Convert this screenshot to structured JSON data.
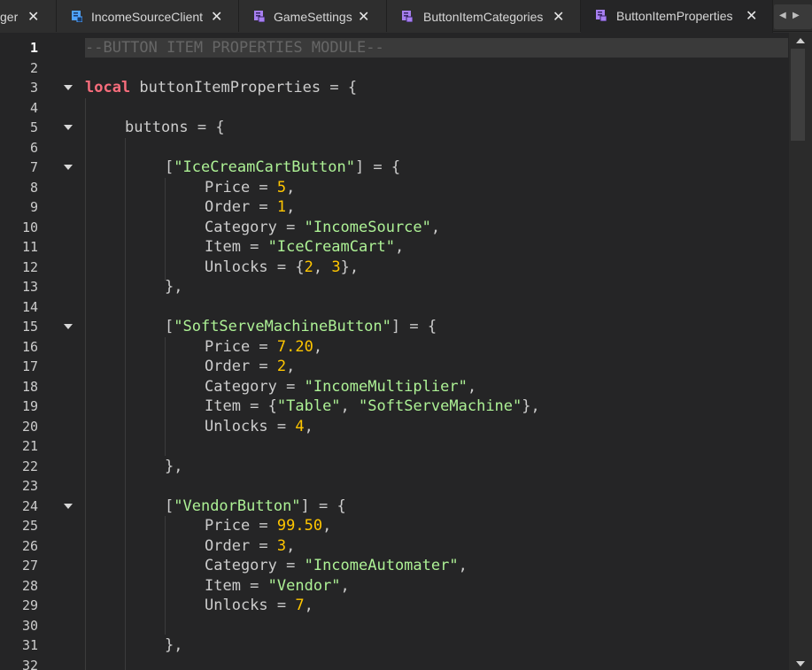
{
  "tabs": [
    {
      "label": "ger",
      "icon": "script-icon",
      "active": false
    },
    {
      "label": "IncomeSourceClient",
      "icon": "local-script-icon",
      "active": false
    },
    {
      "label": "GameSettings",
      "icon": "module-script-icon",
      "active": false
    },
    {
      "label": "ButtonItemCategories",
      "icon": "module-script-icon",
      "active": false
    },
    {
      "label": "ButtonItemProperties",
      "icon": "module-script-icon",
      "active": true
    }
  ],
  "colors": {
    "keyword": "#f86d7c",
    "string": "#adf195",
    "number": "#ffc600",
    "comment": "#666666",
    "text": "#cccccc",
    "local_script_icon": "#4fa3ff",
    "module_script_icon": "#a77ff0"
  },
  "editor": {
    "current_line": 1,
    "lines": [
      {
        "n": "1"
      },
      {
        "n": "2"
      },
      {
        "n": "3"
      },
      {
        "n": "4"
      },
      {
        "n": "5"
      },
      {
        "n": "6"
      },
      {
        "n": "7"
      },
      {
        "n": "8"
      },
      {
        "n": "9"
      },
      {
        "n": "10"
      },
      {
        "n": "11"
      },
      {
        "n": "12"
      },
      {
        "n": "13"
      },
      {
        "n": "14"
      },
      {
        "n": "15"
      },
      {
        "n": "16"
      },
      {
        "n": "17"
      },
      {
        "n": "18"
      },
      {
        "n": "19"
      },
      {
        "n": "20"
      },
      {
        "n": "21"
      },
      {
        "n": "22"
      },
      {
        "n": "23"
      },
      {
        "n": "24"
      },
      {
        "n": "25"
      },
      {
        "n": "26"
      },
      {
        "n": "27"
      },
      {
        "n": "28"
      },
      {
        "n": "29"
      },
      {
        "n": "30"
      },
      {
        "n": "31"
      },
      {
        "n": "32"
      }
    ],
    "code": {
      "l1": "--BUTTON ITEM PROPERTIES MODULE--",
      "l3_kw": "local",
      "l3_rest": " buttonItemProperties = {",
      "l5": "buttons = {",
      "l7_a": "[",
      "l7_s": "\"IceCreamCartButton\"",
      "l7_b": "] = {",
      "l8_a": "Price = ",
      "l8_n": "5",
      "l8_b": ",",
      "l9_a": "Order = ",
      "l9_n": "1",
      "l9_b": ",",
      "l10_a": "Category = ",
      "l10_s": "\"IncomeSource\"",
      "l10_b": ",",
      "l11_a": "Item = ",
      "l11_s": "\"IceCreamCart\"",
      "l11_b": ",",
      "l12_a": "Unlocks = {",
      "l12_n1": "2",
      "l12_c": ", ",
      "l12_n2": "3",
      "l12_b": "},",
      "l13": "},",
      "l15_a": "[",
      "l15_s": "\"SoftServeMachineButton\"",
      "l15_b": "] = {",
      "l16_a": "Price = ",
      "l16_n": "7.20",
      "l16_b": ",",
      "l17_a": "Order = ",
      "l17_n": "2",
      "l17_b": ",",
      "l18_a": "Category = ",
      "l18_s": "\"IncomeMultiplier\"",
      "l18_b": ",",
      "l19_a": "Item = {",
      "l19_s1": "\"Table\"",
      "l19_c": ", ",
      "l19_s2": "\"SoftServeMachine\"",
      "l19_b": "},",
      "l20_a": "Unlocks = ",
      "l20_n": "4",
      "l20_b": ",",
      "l22": "},",
      "l24_a": "[",
      "l24_s": "\"VendorButton\"",
      "l24_b": "] = {",
      "l25_a": "Price = ",
      "l25_n": "99.50",
      "l25_b": ",",
      "l26_a": "Order = ",
      "l26_n": "3",
      "l26_b": ",",
      "l27_a": "Category = ",
      "l27_s": "\"IncomeAutomater\"",
      "l27_b": ",",
      "l28_a": "Item = ",
      "l28_s": "\"Vendor\"",
      "l28_b": ",",
      "l29_a": "Unlocks = ",
      "l29_n": "7",
      "l29_b": ",",
      "l31": "},"
    },
    "fold_lines": [
      "3",
      "5",
      "7",
      "15",
      "24"
    ]
  }
}
